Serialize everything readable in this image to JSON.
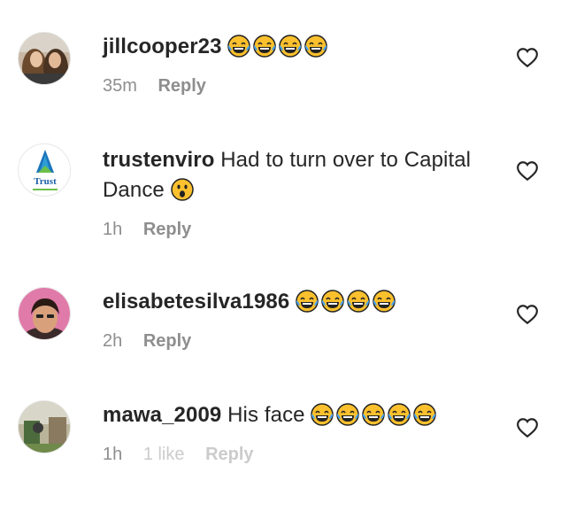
{
  "comments": [
    {
      "username": "jillcooper23",
      "text": "",
      "emoji": [
        "laugh-cry",
        "laugh-cry",
        "laugh-cry",
        "laugh-cry"
      ],
      "time": "35m",
      "like_label": "",
      "reply_label": "Reply",
      "avatar": "two-women-photo"
    },
    {
      "username": "trustenviro",
      "text": "Had to turn over to Capital Dance",
      "emoji": [
        "surprised"
      ],
      "time": "1h",
      "like_label": "",
      "reply_label": "Reply",
      "avatar": "trust-logo",
      "avatar_text": "Trust"
    },
    {
      "username": "elisabetesilva1986",
      "text": "",
      "emoji": [
        "laugh-cry",
        "laugh-cry",
        "laugh-cry",
        "laugh-cry"
      ],
      "time": "2h",
      "like_label": "",
      "reply_label": "Reply",
      "avatar": "woman-selfie-pink"
    },
    {
      "username": "mawa_2009",
      "text": "His face",
      "emoji": [
        "laugh-cry",
        "laugh-cry",
        "laugh-cry",
        "laugh-cry",
        "laugh-cry"
      ],
      "time": "1h",
      "like_label": "1 like",
      "reply_label": "Reply",
      "avatar": "outdoor-photo"
    }
  ],
  "colors": {
    "text": "#262626",
    "meta": "#8e8e8e",
    "emoji_face": "#fbc02d",
    "emoji_tear": "#42a5f5"
  }
}
